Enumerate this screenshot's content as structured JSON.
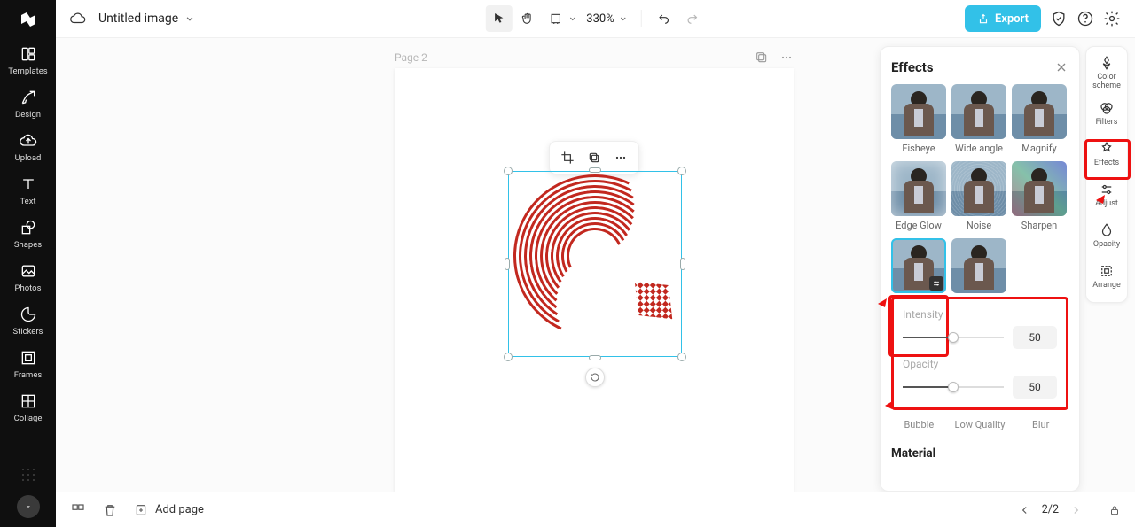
{
  "document": {
    "title": "Untitled image"
  },
  "sidebar": {
    "items": [
      {
        "label": "Templates"
      },
      {
        "label": "Design"
      },
      {
        "label": "Upload"
      },
      {
        "label": "Text"
      },
      {
        "label": "Shapes"
      },
      {
        "label": "Photos"
      },
      {
        "label": "Stickers"
      },
      {
        "label": "Frames"
      },
      {
        "label": "Collage"
      }
    ]
  },
  "toolbar": {
    "zoom": "330%",
    "export_label": "Export"
  },
  "canvas": {
    "page_label": "Page 2"
  },
  "right_rail": {
    "items": [
      {
        "label": "Color scheme"
      },
      {
        "label": "Filters"
      },
      {
        "label": "Effects"
      },
      {
        "label": "Adjust"
      },
      {
        "label": "Opacity"
      },
      {
        "label": "Arrange"
      }
    ]
  },
  "effects_panel": {
    "title": "Effects",
    "row1_labels": [
      "Fisheye",
      "Wide angle",
      "Magnify"
    ],
    "row2_labels": [
      "Edge Glow",
      "Noise",
      "Sharpen"
    ],
    "intensity_label": "Intensity",
    "intensity_value": "50",
    "opacity_label": "Opacity",
    "opacity_value": "50",
    "row3_labels": [
      "Bubble",
      "Low Quality",
      "Blur"
    ],
    "material_title": "Material"
  },
  "bottom": {
    "add_page": "Add page",
    "page_indicator": "2/2"
  }
}
